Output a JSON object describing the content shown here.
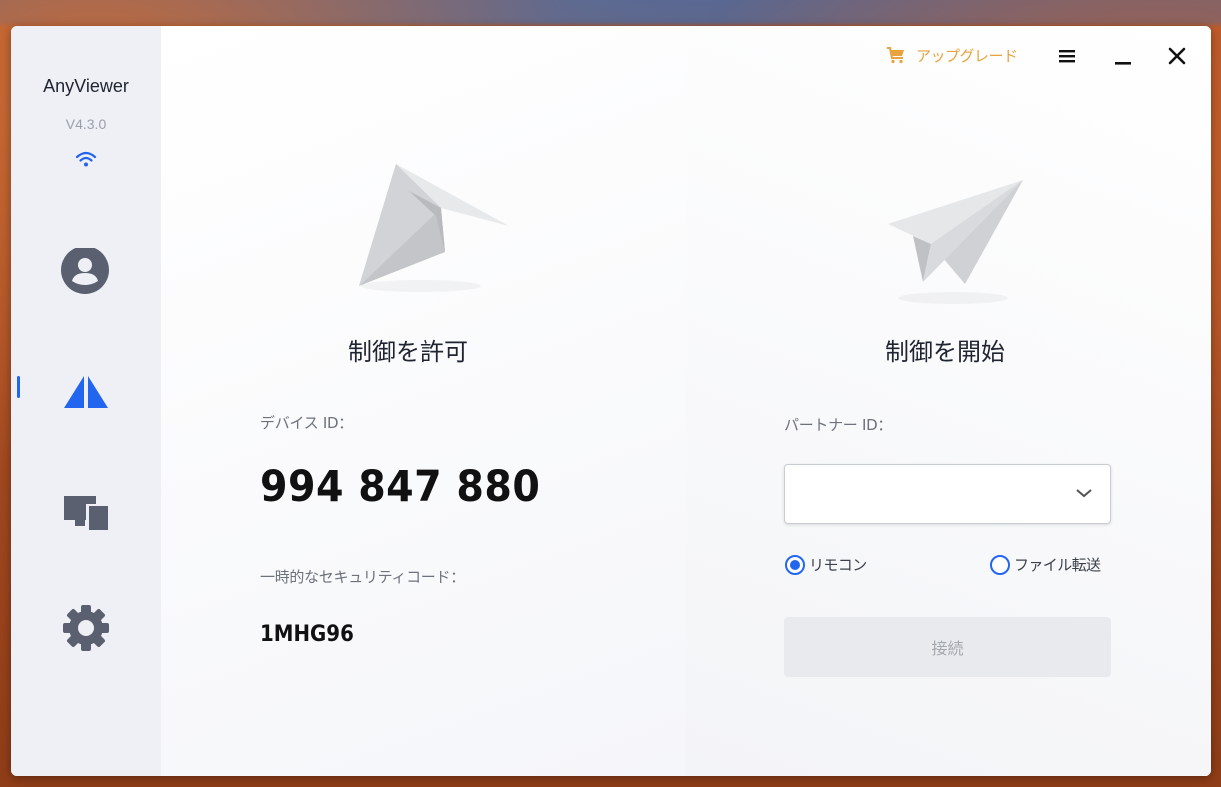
{
  "app": {
    "name": "AnyViewer",
    "version": "V4.3.0"
  },
  "sidebar": {
    "items": [
      {
        "icon": "user-icon"
      },
      {
        "icon": "remote-control-icon",
        "active": true
      },
      {
        "icon": "devices-icon"
      },
      {
        "icon": "gear-icon"
      }
    ]
  },
  "titlebar": {
    "upgrade_label": "アップグレード",
    "upgrade_icon": "cart-icon",
    "menu_icon": "menu-icon",
    "minimize_icon": "minimize-icon",
    "close_icon": "close-icon"
  },
  "allow_control": {
    "title": "制御を許可",
    "device_id_label": "デバイス ID：",
    "device_id": "994 847 880",
    "security_code_label": "一時的なセキュリティコード：",
    "security_code": "1MHG96"
  },
  "start_control": {
    "title": "制御を開始",
    "partner_id_label": "パートナー ID：",
    "partner_id_value": "",
    "partner_id_placeholder": "",
    "mode_options": [
      {
        "label": "リモコン",
        "checked": true
      },
      {
        "label": "ファイル転送",
        "checked": false
      }
    ],
    "connect_label": "接続"
  },
  "colors": {
    "accent": "#2266f0",
    "upgrade": "#e7a33d",
    "sidebar_bg": "#eef0f5",
    "icon_gray": "#5a6070"
  }
}
